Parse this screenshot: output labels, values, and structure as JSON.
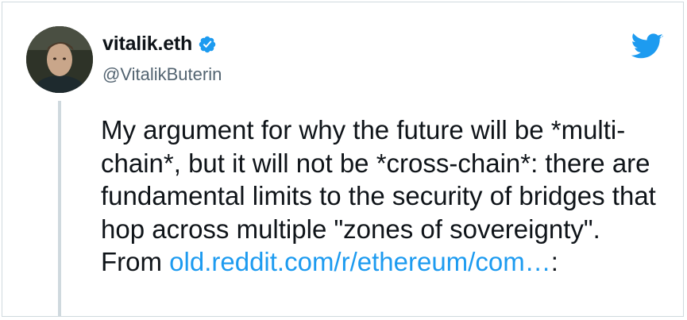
{
  "author": {
    "display_name": "vitalik.eth",
    "handle": "@VitalikButerin",
    "verified": true
  },
  "tweet": {
    "text": "My argument for why the future will be *multi-chain*, but it will not be *cross-chain*: there are fundamental limits to the security of bridges that hop across multiple \"zones of sovereignty\". From",
    "link_text": "old.reddit.com/r/ethereum/com…",
    "trailing_text": ":"
  },
  "icons": {
    "brand": "twitter-bird-icon",
    "verified": "verified-badge-icon"
  },
  "colors": {
    "link": "#1d9bf0",
    "text": "#0f1419",
    "secondary": "#536471",
    "border": "#cfd9de"
  }
}
